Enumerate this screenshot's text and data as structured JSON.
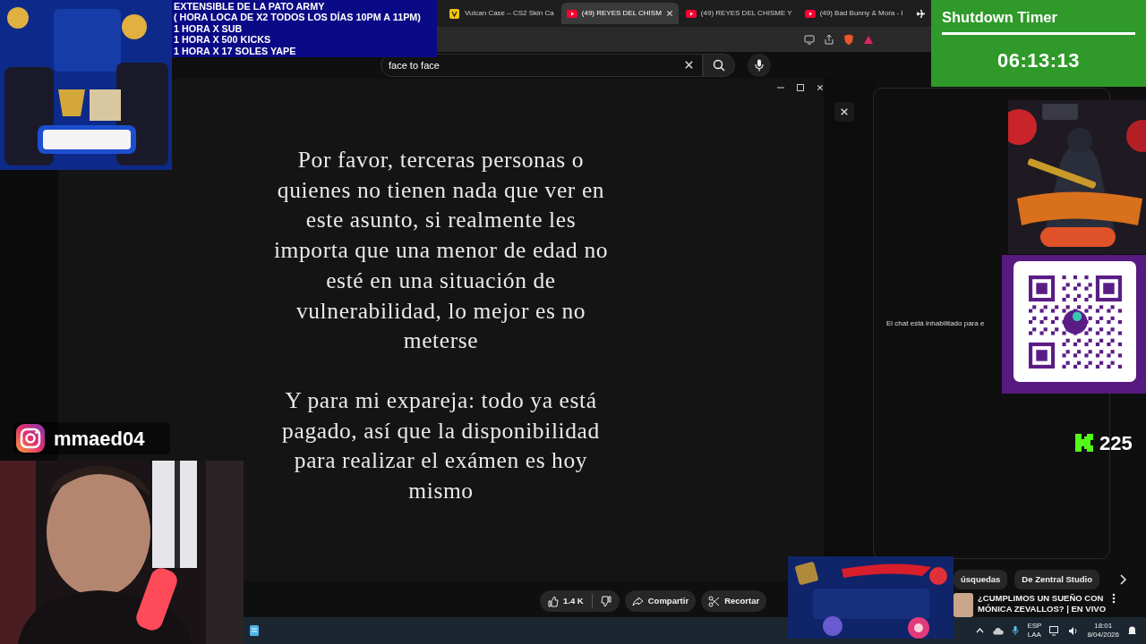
{
  "browser": {
    "tabs": [
      {
        "title": "Vulcan Case – CS2 Skin Ca",
        "kind": "store",
        "selected": false
      },
      {
        "title": "(49) REYES DEL CHISM",
        "kind": "video",
        "selected": true
      },
      {
        "title": "(49) REYES DEL CHISME Y",
        "kind": "video",
        "selected": false
      },
      {
        "title": "(49) Bad Bunny & Mora - I",
        "kind": "video",
        "selected": false
      }
    ]
  },
  "search": {
    "value": "face to face"
  },
  "video": {
    "paragraphs": [
      "Por favor, terceras personas o quienes no tienen nada que ver en este asunto, si realmente les importa que una menor de edad no esté en una situación de vulnerabilidad, lo mejor es no meterse",
      "Y para mi expareja: todo ya está pagado, así que la disponibilidad para realizar el exámen es hoy mismo"
    ]
  },
  "chat": {
    "notice": "El chat está inhabilitado para e"
  },
  "actions": [
    {
      "kind": "like",
      "label": "1.4 K"
    },
    {
      "kind": "share",
      "label": "Compartir"
    },
    {
      "kind": "clip",
      "label": "Recortar"
    }
  ],
  "chips": [
    {
      "label": "úsquedas"
    },
    {
      "label": "De Zentral Studio"
    }
  ],
  "recommended": {
    "title": "¿CUMPLIMOS UN SUEÑO CON MÓNICA ZEVALLOS? | EN VIVO"
  },
  "overlays": {
    "info_lines": [
      "EXTENSIBLE  DE LA PATO ARMY",
      "( HORA LOCA DE X2 TODOS LOS DÍAS 10PM A 11PM)",
      "1 HORA X SUB",
      "1 HORA X 500 KICKS",
      "1 HORA X 17 SOLES YAPE"
    ],
    "timer": {
      "title": "Shutdown Timer",
      "time": "06:13:13"
    },
    "instagram": {
      "handle": "mmaed04"
    },
    "kick": {
      "count": "225"
    }
  },
  "taskbar": {
    "language": "ESP",
    "layout": "LAA",
    "time": "18:01",
    "date": "8/04/2026"
  }
}
